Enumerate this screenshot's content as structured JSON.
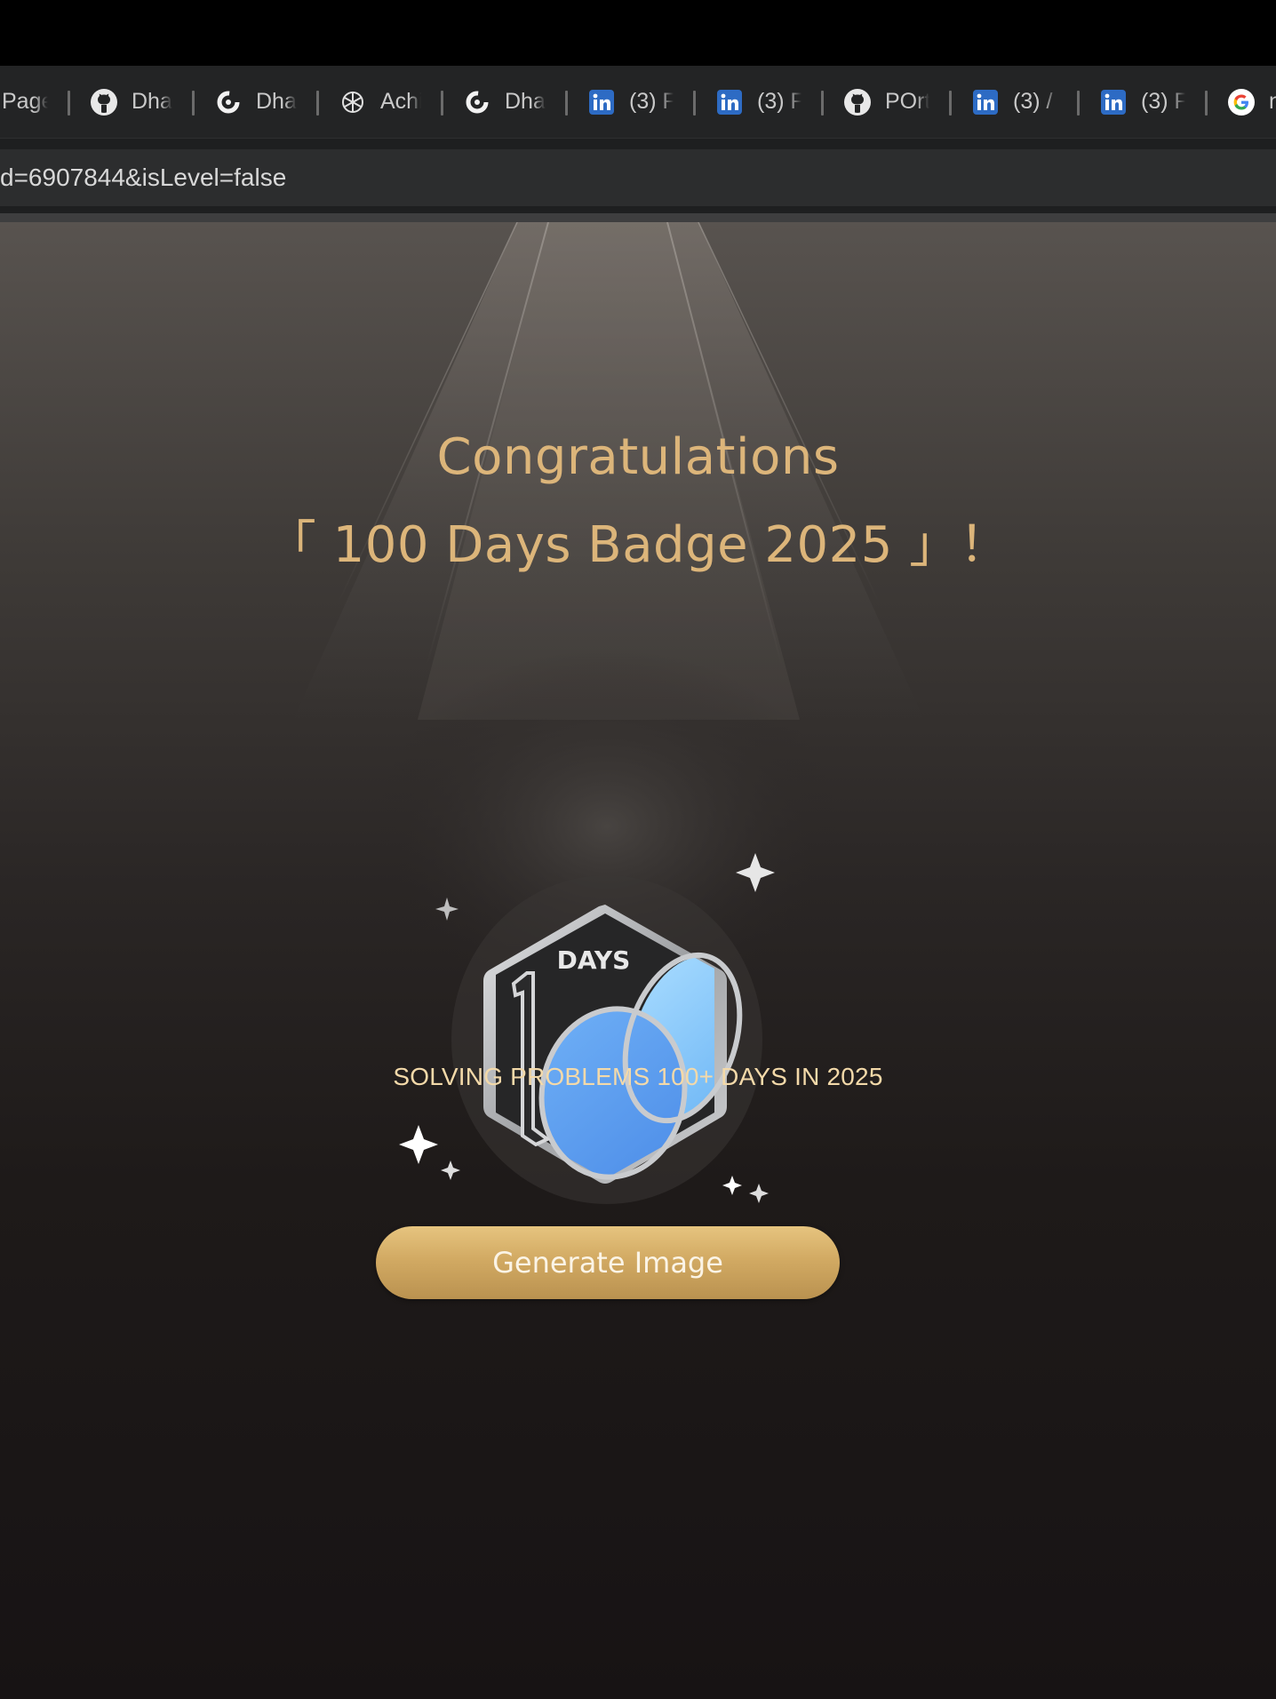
{
  "browser": {
    "bookmarks": [
      {
        "icon": "none",
        "label": "Page"
      },
      {
        "icon": "github-icon",
        "label": "Dhar"
      },
      {
        "icon": "leetcode-icon",
        "label": "Dhar"
      },
      {
        "icon": "chatgpt-icon",
        "label": "Achi"
      },
      {
        "icon": "leetcode-icon",
        "label": "Dhar"
      },
      {
        "icon": "linkedin-icon",
        "label": "(3) F"
      },
      {
        "icon": "linkedin-icon",
        "label": "(3) F"
      },
      {
        "icon": "github-icon",
        "label": "POrt"
      },
      {
        "icon": "linkedin-icon",
        "label": "(3) /"
      },
      {
        "icon": "linkedin-icon",
        "label": "(3) F"
      },
      {
        "icon": "google-icon",
        "label": "n"
      }
    ],
    "url": "d=6907844&isLevel=false"
  },
  "page": {
    "headline_line1": "Congratulations",
    "headline_line2": "「 100 Days Badge 2025 」！",
    "badge": {
      "top_text": "DAYS",
      "number_digit": "1",
      "colors": {
        "frame": "#b9bbbe",
        "plate": "#2a2a2b",
        "fill": "#5d9ef0"
      }
    },
    "subtitle": "SOLVING PROBLEMS 100+ DAYS IN 2025",
    "button_label": "Generate Image"
  },
  "colors": {
    "accent_gold": "#dcb57a",
    "subtitle": "#f3d9a9"
  }
}
